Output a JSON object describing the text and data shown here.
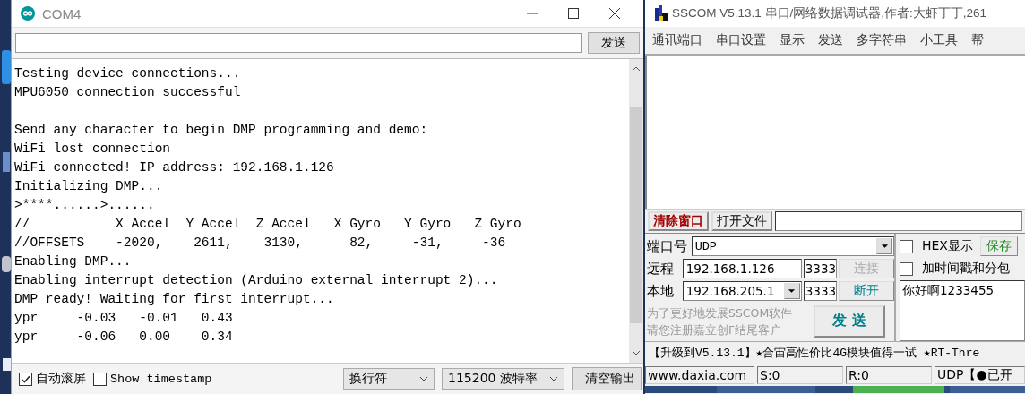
{
  "arduino_window": {
    "title": "COM4",
    "send_button": "发送",
    "output_blocks": [
      [
        "Testing device connections...",
        "MPU6050 connection successful"
      ],
      [
        "Send any character to begin DMP programming and demo:",
        "WiFi lost connection",
        "WiFi connected! IP address: 192.168.1.126",
        "Initializing DMP...",
        ">****......>......",
        "//           X Accel  Y Accel  Z Accel   X Gyro   Y Gyro   Z Gyro",
        "//OFFSETS    -2020,    2611,    3130,      82,     -31,     -36",
        "Enabling DMP...",
        "Enabling interrupt detection (Arduino external interrupt 2)...",
        "DMP ready! Waiting for first interrupt...",
        "ypr     -0.03   -0.01   0.43",
        "ypr     -0.06   0.00    0.34"
      ]
    ],
    "autoscroll": {
      "label": "自动滚屏",
      "checked": true
    },
    "timestamp": {
      "label": "Show timestamp",
      "checked": false
    },
    "line_ending": "换行符",
    "baud_rate": "115200 波特率",
    "clear_button": "清空输出"
  },
  "sscom_window": {
    "title": "SSCOM V5.13.1 串口/网络数据调试器,作者:大虾丁丁,261",
    "menu": [
      "通讯端口",
      "串口设置",
      "显示",
      "发送",
      "多字符串",
      "小工具",
      "帮"
    ],
    "clear_button": "清除窗口",
    "open_file_button": "打开文件",
    "port_label": "端口号",
    "port_value": "UDP",
    "remote_label": "远程",
    "remote_ip": "192.168.1.126",
    "remote_port": "3333",
    "connect_button": {
      "label": "连接",
      "disabled": true
    },
    "local_label": "本地",
    "local_ip": "192.168.205.1",
    "local_port": "3333",
    "disconnect_button": "断开",
    "promo_lines": [
      "为了更好地发展SSCOM软件",
      "请您注册嘉立创F结尾客户"
    ],
    "send_button": "发 送",
    "hex_display": {
      "label": "HEX显示",
      "checked": false
    },
    "save_button": "保存",
    "timestamp": {
      "label": "加时间戳和分包",
      "checked": false
    },
    "send_text": "你好啊1233455",
    "ticker": "【升级到V5.13.1】★合宙高性价比4G模块值得一试 ★RT-Thre",
    "status": [
      "www.daxia.com",
      "S:0",
      "R:0",
      "UDP【●已开"
    ]
  }
}
